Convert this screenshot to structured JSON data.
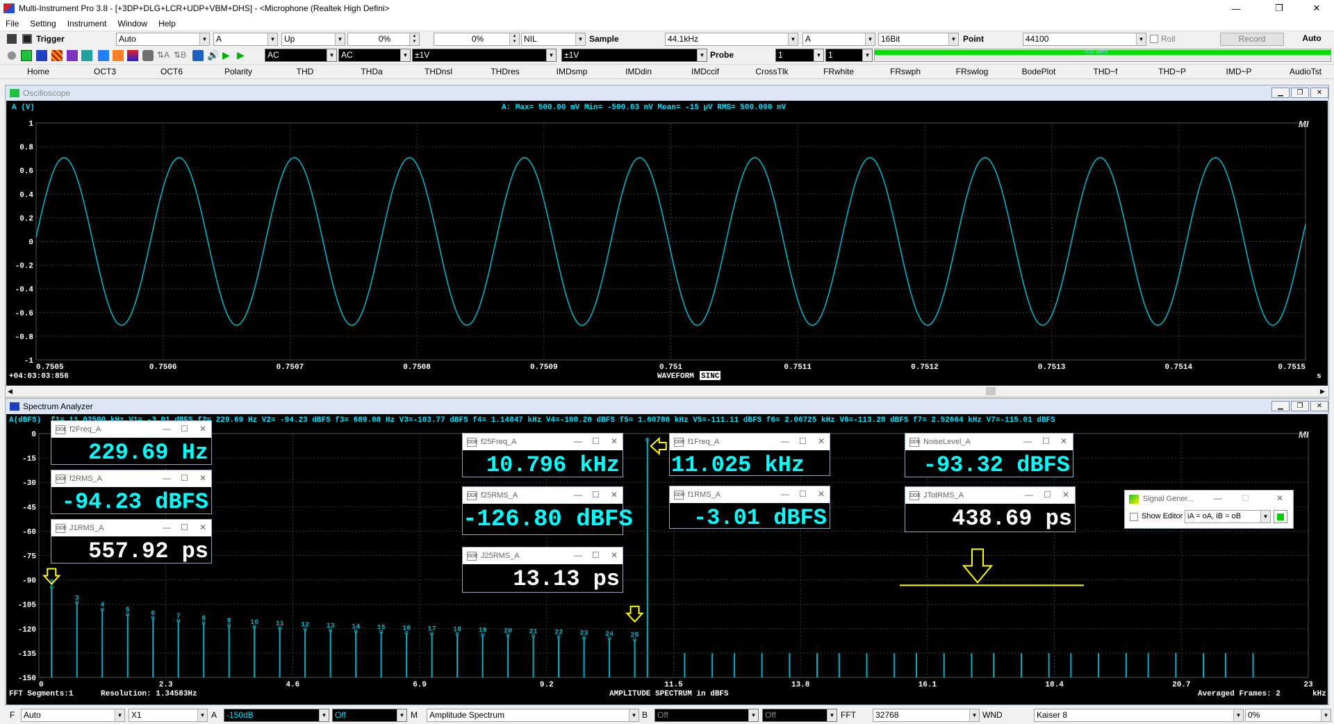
{
  "window": {
    "title": "Multi-Instrument Pro 3.8   -   [+3DP+DLG+LCR+UDP+VBM+DHS]   -   <Microphone (Realtek High Defini>",
    "controls": [
      "—",
      "❐",
      "✕"
    ]
  },
  "menu": [
    "File",
    "Setting",
    "Instrument",
    "Window",
    "Help"
  ],
  "toolbar1": {
    "trigger_label": "Trigger",
    "trigger_mode": "Auto",
    "trigger_channel": "A",
    "trigger_edge": "Up",
    "trigger_level": "0%",
    "trigger_delay": "0%",
    "trigger_nil": "NIL",
    "sample_label": "Sample",
    "sample_rate": "44.1kHz",
    "sample_channel": "A",
    "bits": "16Bit",
    "point_label": "Point",
    "points": "44100",
    "roll_label": "Roll",
    "record_label": "Record",
    "auto_label": "Auto"
  },
  "toolbar2": {
    "coupling_a": "AC",
    "coupling_b": "AC",
    "range_a": "±1V",
    "range_b": "±1V",
    "probe_label": "Probe",
    "probe_a": "1",
    "probe_b": "1",
    "level_meter_fraction": 1.0,
    "level_meter_text": "-3.01 dBFS",
    "level_meter_color": "#00e000"
  },
  "tabs": [
    "Home",
    "OCT3",
    "OCT6",
    "Polarity",
    "THD",
    "THDa",
    "THDnsl",
    "THDres",
    "IMDsmp",
    "IMDdin",
    "IMDccif",
    "CrossTlk",
    "FRwhite",
    "FRswph",
    "FRswlog",
    "BodePlot",
    "THD~f",
    "THD~P",
    "IMD~P",
    "AudioTst"
  ],
  "oscilloscope": {
    "title": "Oscilloscope",
    "ylabel": "A (V)",
    "readout": "A: Max=  500.00 mV  Min= -500.03 mV  Mean=       -15 μV  RMS=  500.000 mV",
    "start_time": "+04:03:03:856",
    "footer": "WAVEFORM",
    "footer_badge": "SINC",
    "unit_s": "s",
    "mi_logo": "MI"
  },
  "spectrum": {
    "title": "Spectrum Analyzer",
    "ylabel": "A(dBFS)",
    "readout": "f1=  11.02500 kHz V1=  -3.01 dBFS  f2=    229.69  Hz V2= -94.23 dBFS  f3=    689.08  Hz V3=-103.77 dBFS  f4=  1.14847 kHz V4=-108.20 dBFS  f5=  1.60786 kHz V5=-111.11 dBFS  f6=  2.06725 kHz V6=-113.28 dBFS  f7=  2.52664 kHz V7=-115.01 dBFS",
    "fft_segments": "FFT Segments:1",
    "resolution": "Resolution: 1.34583Hz",
    "footer": "AMPLITUDE SPECTRUM in dBFS",
    "averaged": "Averaged Frames: 2",
    "unit_khz": "kHz",
    "mi_logo": "MI"
  },
  "chart_data": [
    {
      "type": "line",
      "title": "",
      "xlabel": "",
      "ylabel": "A (V)",
      "x_ticks": [
        "0.7505",
        "0.7506",
        "0.7507",
        "0.7508",
        "0.7509",
        "0.751",
        "0.7511",
        "0.7512",
        "0.7513",
        "0.7514",
        "0.7515"
      ],
      "y_ticks": [
        "1",
        "0.8",
        "0.6",
        "0.4",
        "0.2",
        "0",
        "-0.2",
        "-0.4",
        "-0.6",
        "-0.8",
        "-1"
      ],
      "xlim": [
        0.7505,
        0.7515
      ],
      "ylim": [
        -1,
        1
      ],
      "series": [
        {
          "name": "",
          "frequency_hz": 11025,
          "amplitude": 0.7071,
          "color": "#00b4c8"
        }
      ],
      "grid": true
    },
    {
      "type": "bar",
      "title": "",
      "xlabel": "",
      "ylabel": "A(dBFS)",
      "x_ticks": [
        "0",
        "2.3",
        "4.6",
        "6.9",
        "9.2",
        "11.5",
        "13.8",
        "16.1",
        "18.4",
        "20.7",
        "23"
      ],
      "y_ticks": [
        "0",
        "-15",
        "-30",
        "-45",
        "-60",
        "-75",
        "-90",
        "-105",
        "-120",
        "-135",
        "-150"
      ],
      "xlim": [
        0,
        23
      ],
      "ylim": [
        -150,
        0
      ],
      "fundamental": {
        "freq_khz": 11.025,
        "level_dbfs": -3.01
      },
      "harmonic_labels": [
        "2",
        "3",
        "4",
        "5",
        "6",
        "7",
        "8",
        "9",
        "10",
        "11",
        "12",
        "13",
        "14",
        "15",
        "16",
        "17",
        "18",
        "19",
        "20",
        "21",
        "22",
        "23",
        "24",
        "25"
      ],
      "harmonics": [
        {
          "freq_khz": 0.22969,
          "level_dbfs": -94.23
        },
        {
          "freq_khz": 0.68908,
          "level_dbfs": -103.77
        },
        {
          "freq_khz": 1.14847,
          "level_dbfs": -108.2
        },
        {
          "freq_khz": 1.60786,
          "level_dbfs": -111.11
        },
        {
          "freq_khz": 2.06725,
          "level_dbfs": -113.28
        },
        {
          "freq_khz": 2.52664,
          "level_dbfs": -115.01
        },
        {
          "freq_khz": 2.98603,
          "level_dbfs": -116.5
        },
        {
          "freq_khz": 3.44542,
          "level_dbfs": -117.8
        },
        {
          "freq_khz": 3.90481,
          "level_dbfs": -118.8
        },
        {
          "freq_khz": 4.3642,
          "level_dbfs": -119.6
        },
        {
          "freq_khz": 4.82359,
          "level_dbfs": -120.3
        },
        {
          "freq_khz": 5.28298,
          "level_dbfs": -120.9
        },
        {
          "freq_khz": 5.74237,
          "level_dbfs": -121.5
        },
        {
          "freq_khz": 6.20176,
          "level_dbfs": -122.0
        },
        {
          "freq_khz": 6.66115,
          "level_dbfs": -122.5
        },
        {
          "freq_khz": 7.12054,
          "level_dbfs": -122.9
        },
        {
          "freq_khz": 7.57993,
          "level_dbfs": -123.3
        },
        {
          "freq_khz": 8.03932,
          "level_dbfs": -123.7
        },
        {
          "freq_khz": 8.49871,
          "level_dbfs": -124.1
        },
        {
          "freq_khz": 8.9581,
          "level_dbfs": -124.5
        },
        {
          "freq_khz": 9.41749,
          "level_dbfs": -125.0
        },
        {
          "freq_khz": 9.87688,
          "level_dbfs": -125.5
        },
        {
          "freq_khz": 10.33627,
          "level_dbfs": -126.0
        },
        {
          "freq_khz": 10.79566,
          "level_dbfs": -126.8
        }
      ],
      "upper_spurs_khz": [
        11.7,
        12.2,
        12.6,
        13.1,
        13.6,
        14.1,
        14.5,
        15.0,
        15.5,
        15.9,
        16.4,
        16.9,
        17.3,
        17.8,
        18.3,
        18.7,
        19.2,
        19.7,
        20.1,
        20.6,
        21.1,
        21.5,
        22.0
      ],
      "upper_spur_level_dbfs": -135,
      "noise_level_line_dbfs": -93.32,
      "grid": true
    }
  ],
  "meters": {
    "f2freq": {
      "name": "f2Freq_A",
      "value": "229.69 Hz"
    },
    "f2rms": {
      "name": "f2RMS_A",
      "value": "-94.23 dBFS"
    },
    "j1rms": {
      "name": "J1RMS_A",
      "value": "557.92 ps"
    },
    "f25freq": {
      "name": "f25Freq_A",
      "value": "10.796 kHz"
    },
    "f25rms": {
      "name": "f25RMS_A",
      "value": "-126.80 dBFS"
    },
    "j25rms": {
      "name": "J25RMS_A",
      "value": "13.13 ps"
    },
    "f1freq": {
      "name": "f1Freq_A",
      "value": "11.025 kHz"
    },
    "f1rms": {
      "name": "f1RMS_A",
      "value": "-3.01 dBFS"
    },
    "noise": {
      "name": "NoiseLevel_A",
      "value": "-93.32 dBFS"
    },
    "jtot": {
      "name": "JTotRMS_A",
      "value": "438.69 ps"
    }
  },
  "siggen": {
    "title": "Signal Gener...",
    "show_editor": "Show Editor",
    "mapping": "iA = oA, iB = oB"
  },
  "statusbar": {
    "f_label": "F",
    "f_mode": "Auto",
    "x_scale": "X1",
    "a_label": "A",
    "a_range": "-150dB",
    "a_off": "Off",
    "m_label": "M",
    "m_mode": "Amplitude Spectrum",
    "b_label": "B",
    "b_off1": "Off",
    "b_off2": "Off",
    "fft_label": "FFT",
    "fft_size": "32768",
    "wnd_label": "WND",
    "window": "Kaiser 8",
    "overlap": "0%"
  },
  "colors": {
    "trace": "#00b4c8",
    "meter_text": "#00ffff",
    "marker": "#ffff00",
    "grid": "#3a3a3a"
  }
}
